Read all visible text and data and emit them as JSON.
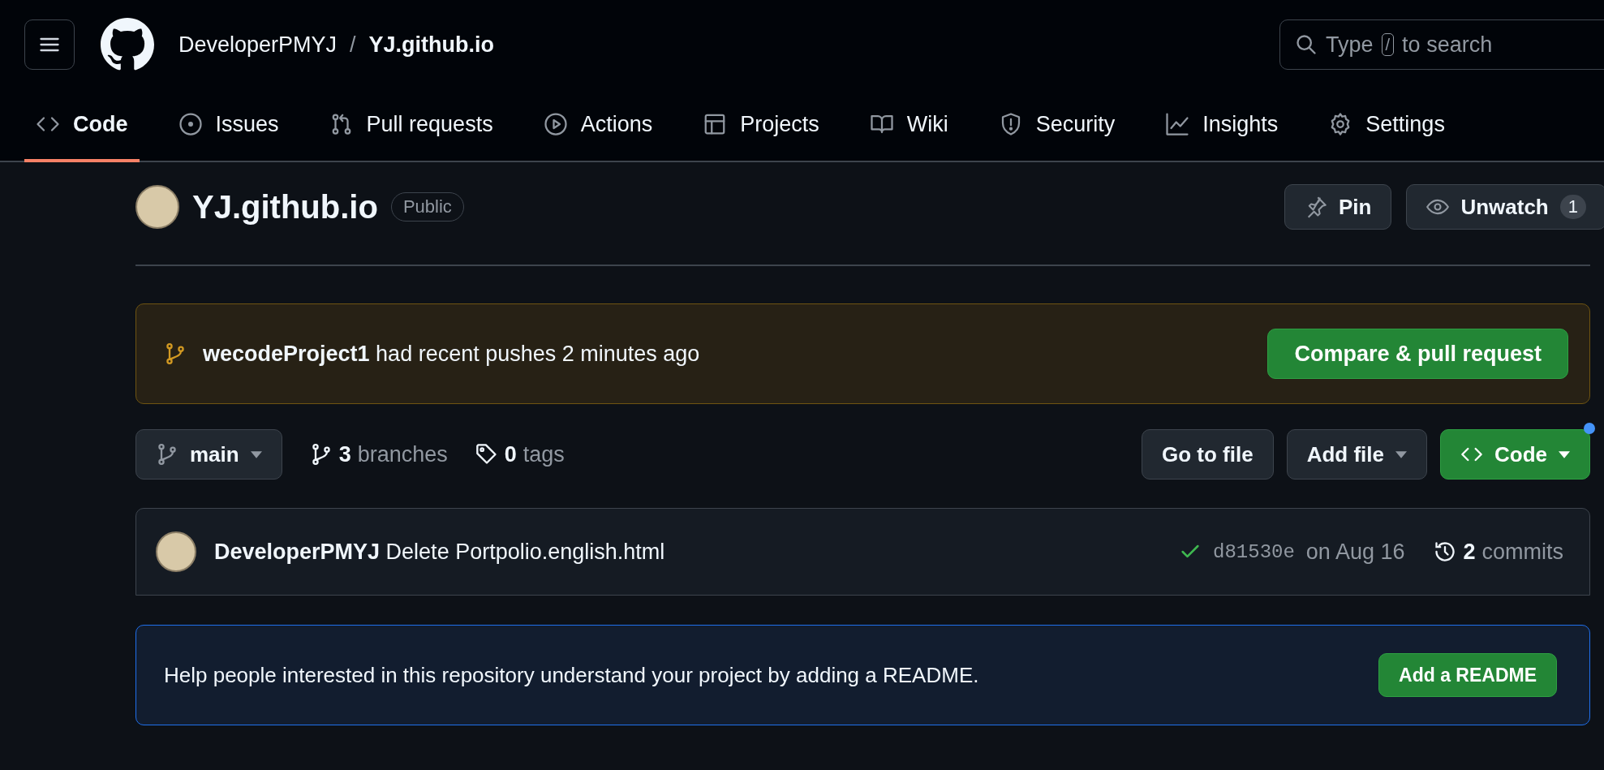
{
  "header": {
    "owner": "DeveloperPMYJ",
    "separator": "/",
    "repo": "YJ.github.io",
    "search": {
      "prefix": "Type",
      "key": "/",
      "suffix": "to search"
    }
  },
  "tabs": [
    {
      "label": "Code",
      "selected": true
    },
    {
      "label": "Issues",
      "selected": false
    },
    {
      "label": "Pull requests",
      "selected": false
    },
    {
      "label": "Actions",
      "selected": false
    },
    {
      "label": "Projects",
      "selected": false
    },
    {
      "label": "Wiki",
      "selected": false
    },
    {
      "label": "Security",
      "selected": false
    },
    {
      "label": "Insights",
      "selected": false
    },
    {
      "label": "Settings",
      "selected": false
    }
  ],
  "repo": {
    "name": "YJ.github.io",
    "visibility": "Public",
    "pin": "Pin",
    "watch": "Unwatch",
    "watch_count": "1"
  },
  "push_banner": {
    "branch": "wecodeProject1",
    "message": "had recent pushes 2 minutes ago",
    "button": "Compare & pull request"
  },
  "toolbar": {
    "branch": "main",
    "branches_count": "3",
    "branches_label": "branches",
    "tags_count": "0",
    "tags_label": "tags",
    "go_to_file": "Go to file",
    "add_file": "Add file",
    "code": "Code"
  },
  "last_commit": {
    "author": "DeveloperPMYJ",
    "message": "Delete Portpolio.english.html",
    "hash": "d81530e",
    "date": "on Aug 16",
    "commits_count": "2",
    "commits_label": "commits"
  },
  "readme_banner": {
    "text": "Help people interested in this repository understand your project by adding a README.",
    "button": "Add a README"
  }
}
